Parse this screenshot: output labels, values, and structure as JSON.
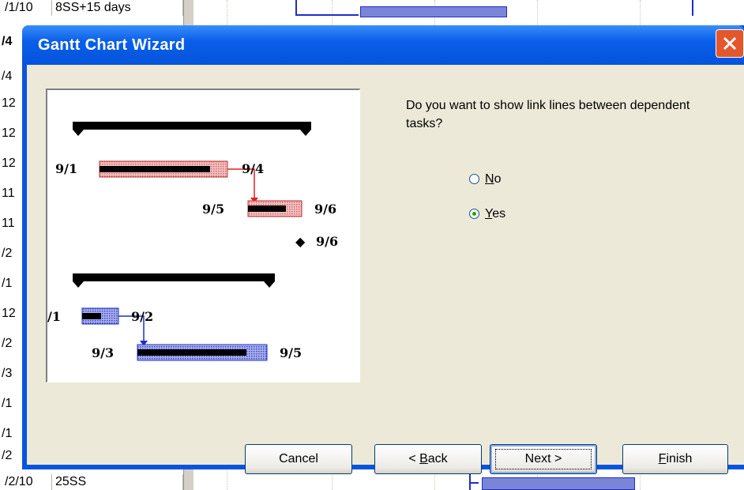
{
  "background": {
    "rows": [
      {
        "col_a": "/1/10",
        "col_b": "8SS+15 days"
      },
      {
        "col_a": "/2/10",
        "col_b": "25SS"
      }
    ],
    "row_stubs": [
      "/4",
      "/4",
      "12",
      "12",
      "12",
      "11",
      "11",
      "/2",
      "/1",
      "12",
      "/2",
      "/3",
      "/1",
      "/1",
      "/2"
    ]
  },
  "dialog": {
    "title": "Gantt Chart Wizard",
    "question": "Do you want to show link lines between dependent tasks?",
    "options": [
      {
        "label_hot": "N",
        "label_rest": "o",
        "label_pre": "",
        "selected": false
      },
      {
        "label_hot": "Y",
        "label_rest": "es",
        "label_pre": "",
        "selected": true
      }
    ],
    "buttons": {
      "cancel": "Cancel",
      "back_pre": "< ",
      "back_hot": "B",
      "back_rest": "ack",
      "next": "Next >",
      "finish_hot": "F",
      "finish_rest": "inish"
    },
    "preview": {
      "labels": [
        "9/1",
        "9/4",
        "9/5",
        "9/6",
        "9/6",
        "/1",
        "9/2",
        "9/3",
        "9/5"
      ],
      "milestone_glyph": "◆"
    },
    "colors": {
      "accent": "#0855dd",
      "red_bar": "#e38b8b",
      "red_link": "#e02020",
      "blue_bar": "#6f79d6",
      "blue_link": "#1e2fc9",
      "radio_dot": "#21a121",
      "close": "#e4562c"
    }
  }
}
